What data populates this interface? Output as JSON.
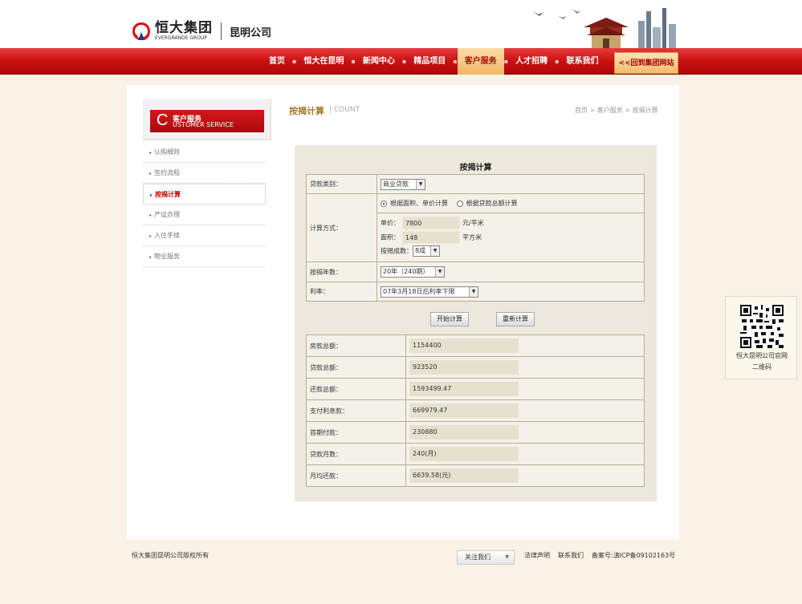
{
  "header": {
    "logo_cn": "恒大集团",
    "logo_en": "EVERGRANDE GROUP",
    "city": "昆明公司",
    "back_link": "<<回到集团网站"
  },
  "nav": {
    "items": [
      {
        "label": "首页",
        "active": false
      },
      {
        "label": "恒大在昆明",
        "active": false
      },
      {
        "label": "新闻中心",
        "active": false
      },
      {
        "label": "精品项目",
        "active": false
      },
      {
        "label": "客户服务",
        "active": true
      },
      {
        "label": "人才招聘",
        "active": false
      },
      {
        "label": "联系我们",
        "active": false
      }
    ],
    "separator": "▪"
  },
  "sidebar": {
    "c_letter": "C",
    "title_cn": "客户服务",
    "title_en": "USTOMER SERVICE",
    "items": [
      {
        "label": "认购细则",
        "active": false
      },
      {
        "label": "签约流程",
        "active": false
      },
      {
        "label": "按揭计算",
        "active": true
      },
      {
        "label": "产证办理",
        "active": false
      },
      {
        "label": "入住手续",
        "active": false
      },
      {
        "label": "物业服务",
        "active": false
      }
    ]
  },
  "page": {
    "title": "按揭计算",
    "title_en": "| COUNT",
    "breadcrumb": "首页 > 客户服务 > 按揭计算"
  },
  "calculator": {
    "title": "按揭计算",
    "loan_type_label": "贷款类别：",
    "loan_type_value": "商业贷款",
    "method_label": "计算方式：",
    "method_option_1": "根据面积、单价计算",
    "method_option_2": "根据贷款总额计算",
    "unit_price_label": "单价：",
    "unit_price_value": "7800",
    "unit_price_unit": "元/平米",
    "area_label": "面积：",
    "area_value": "148",
    "area_unit": "平方米",
    "ratio_label": "按揭成数：",
    "ratio_value": "8成",
    "years_label": "按揭年数：",
    "years_value": "20年（240期）",
    "rate_label": "利率：",
    "rate_value": "07年3月18日后利率下限",
    "start_button": "开始计算",
    "reset_button": "重新计算"
  },
  "results": [
    {
      "label": "房款总额：",
      "value": "1154400"
    },
    {
      "label": "贷款总额：",
      "value": "923520"
    },
    {
      "label": "还款总额：",
      "value": "1593499.47"
    },
    {
      "label": "支付利息款：",
      "value": "669979.47"
    },
    {
      "label": "首期付款：",
      "value": "230880"
    },
    {
      "label": "贷款月数：",
      "value": "240(月)"
    },
    {
      "label": "月均还款：",
      "value": "6639.58(元)"
    }
  ],
  "qr": {
    "line1": "恒大昆明公司官网",
    "line2": "二维码"
  },
  "footer": {
    "copyright": "恒大集团昆明公司版权所有",
    "follow": "关注我们",
    "legal": "法律声明",
    "contact": "联系我们",
    "icp": "备案号:滇ICP备09102163号"
  },
  "colors": {
    "nav_red": "#c80f0f",
    "active_tab": "#f2b765",
    "page_bg": "#f8f3e6",
    "accent_gold": "#a77a35"
  }
}
